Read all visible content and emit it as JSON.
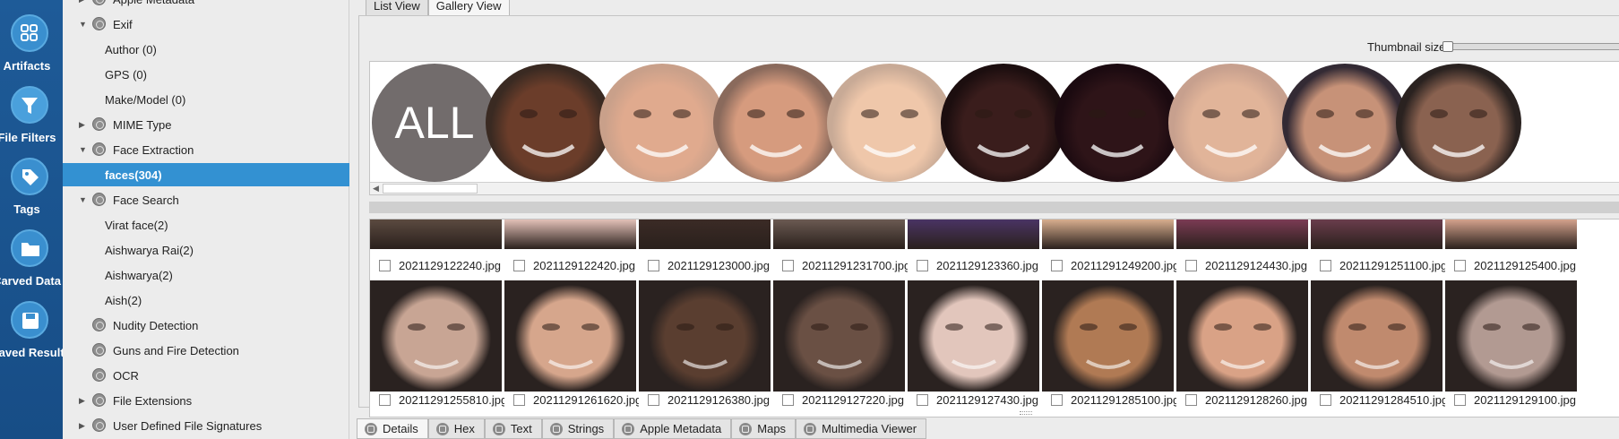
{
  "rail": {
    "items": [
      {
        "label": "Artifacts",
        "icon": "grid-icon"
      },
      {
        "label": "File Filters",
        "icon": "filter-icon"
      },
      {
        "label": "Tags",
        "icon": "tag-icon"
      },
      {
        "label": "Carved Data",
        "icon": "folder-icon"
      },
      {
        "label": "Saved Result",
        "icon": "save-icon"
      }
    ]
  },
  "tree": {
    "items": [
      {
        "label": "Apple Metadata",
        "depth": 1,
        "expander": "collapsed",
        "icon": "apple-icon"
      },
      {
        "label": "Exif",
        "depth": 1,
        "expander": "expanded",
        "icon": "filter-node-icon"
      },
      {
        "label": "Author (0)",
        "depth": 2,
        "expander": "none",
        "icon": ""
      },
      {
        "label": "GPS (0)",
        "depth": 2,
        "expander": "none",
        "icon": ""
      },
      {
        "label": "Make/Model (0)",
        "depth": 2,
        "expander": "none",
        "icon": ""
      },
      {
        "label": "MIME Type",
        "depth": 1,
        "expander": "collapsed",
        "icon": "filter-node-icon"
      },
      {
        "label": "Face Extraction",
        "depth": 1,
        "expander": "expanded",
        "icon": "filter-node-icon"
      },
      {
        "label": "faces(304)",
        "depth": 2,
        "expander": "none",
        "icon": "",
        "selected": true
      },
      {
        "label": "Face Search",
        "depth": 1,
        "expander": "expanded",
        "icon": "filter-node-icon"
      },
      {
        "label": "Virat face(2)",
        "depth": 2,
        "expander": "none",
        "icon": ""
      },
      {
        "label": "Aishwarya Rai(2)",
        "depth": 2,
        "expander": "none",
        "icon": ""
      },
      {
        "label": "Aishwarya(2)",
        "depth": 2,
        "expander": "none",
        "icon": ""
      },
      {
        "label": "Aish(2)",
        "depth": 2,
        "expander": "none",
        "icon": ""
      },
      {
        "label": "Nudity Detection",
        "depth": 1,
        "expander": "none",
        "icon": "filter-node-icon"
      },
      {
        "label": "Guns and Fire Detection",
        "depth": 1,
        "expander": "none",
        "icon": "filter-node-icon"
      },
      {
        "label": "OCR",
        "depth": 1,
        "expander": "none",
        "icon": "filter-node-icon"
      },
      {
        "label": "File Extensions",
        "depth": 1,
        "expander": "collapsed",
        "icon": "filter-node-icon"
      },
      {
        "label": "User Defined File Signatures",
        "depth": 1,
        "expander": "collapsed",
        "icon": "filter-node-icon"
      }
    ]
  },
  "view_tabs": [
    {
      "label": "List View",
      "active": false
    },
    {
      "label": "Gallery View",
      "active": true
    }
  ],
  "thumbnail": {
    "label": "Thumbnail size:",
    "value": 0
  },
  "face_strip": {
    "all_label": "ALL",
    "faces": [
      {
        "skin": "#6b3d2a",
        "bg": "#3a2a22"
      },
      {
        "skin": "#e0aa8e",
        "bg": "#c9a08a"
      },
      {
        "skin": "#d69b7e",
        "bg": "#8a6a5c"
      },
      {
        "skin": "#efc7aa",
        "bg": "#c8aa96"
      },
      {
        "skin": "#3a1d1c",
        "bg": "#1c0e0f"
      },
      {
        "skin": "#2e1418",
        "bg": "#1b0a10"
      },
      {
        "skin": "#e1b499",
        "bg": "#c7a08e"
      },
      {
        "skin": "#c79278",
        "bg": "#332a34"
      },
      {
        "skin": "#8a6250",
        "bg": "#2a2220"
      }
    ]
  },
  "grid": {
    "row1": [
      {
        "name": "2021129122240.jpg",
        "color": "#5b4a40"
      },
      {
        "name": "2021129122420.jpg",
        "color": "#e3c1b8"
      },
      {
        "name": "2021129123000.jpg",
        "color": "#3b2b26"
      },
      {
        "name": "20211291231700.jpg",
        "color": "#6b5a52"
      },
      {
        "name": "2021129123360.jpg",
        "color": "#4a3464"
      },
      {
        "name": "20211291249200.jpg",
        "color": "#d8ae8e"
      },
      {
        "name": "2021129124430.jpg",
        "color": "#7b3b54"
      },
      {
        "name": "20211291251100.jpg",
        "color": "#6a3d4c"
      },
      {
        "name": "2021129125400.jpg",
        "color": "#d4a28c"
      }
    ],
    "row2": [
      {
        "name": "20211291255810.jpg",
        "color": "#c8a594"
      },
      {
        "name": "20211291261620.jpg",
        "color": "#d6a68c"
      },
      {
        "name": "2021129126380.jpg",
        "color": "#5a3e30"
      },
      {
        "name": "2021129127220.jpg",
        "color": "#6a5044"
      },
      {
        "name": "2021129127430.jpg",
        "color": "#e2c6bc"
      },
      {
        "name": "20211291285100.jpg",
        "color": "#b07a54"
      },
      {
        "name": "2021129128260.jpg",
        "color": "#d9a286"
      },
      {
        "name": "20211291284510.jpg",
        "color": "#c08a6e"
      },
      {
        "name": "2021129129100.jpg",
        "color": "#b29a92"
      }
    ]
  },
  "bottom_tabs": [
    {
      "label": "Details",
      "active": true,
      "icon": "details-icon"
    },
    {
      "label": "Hex",
      "active": false,
      "icon": "hex-icon"
    },
    {
      "label": "Text",
      "active": false,
      "icon": "text-icon"
    },
    {
      "label": "Strings",
      "active": false,
      "icon": "strings-icon"
    },
    {
      "label": "Apple Metadata",
      "active": false,
      "icon": "apple-icon"
    },
    {
      "label": "Maps",
      "active": false,
      "icon": "map-icon"
    },
    {
      "label": "Multimedia Viewer",
      "active": false,
      "icon": "multimedia-icon"
    }
  ]
}
